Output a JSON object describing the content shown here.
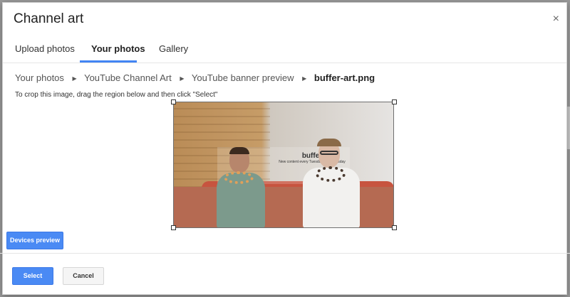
{
  "dialog": {
    "title": "Channel art",
    "close_label": "×"
  },
  "tabs": [
    {
      "label": "Upload photos",
      "active": false
    },
    {
      "label": "Your photos",
      "active": true
    },
    {
      "label": "Gallery",
      "active": false
    }
  ],
  "breadcrumb": {
    "items": [
      "Your photos",
      "YouTube Channel Art",
      "YouTube banner preview"
    ],
    "current": "buffer-art.png",
    "separator_icon": "triangle-right"
  },
  "instructions": "To crop this image, drag the region below and then click \"Select\"",
  "image": {
    "watermark_logo": "buffer",
    "watermark_text": "New content every Tuesday and Thursday"
  },
  "buttons": {
    "devices_preview": "Devices preview",
    "select": "Select",
    "cancel": "Cancel"
  },
  "colors": {
    "accent": "#4285f4",
    "primary_button": "#4a8af4"
  }
}
